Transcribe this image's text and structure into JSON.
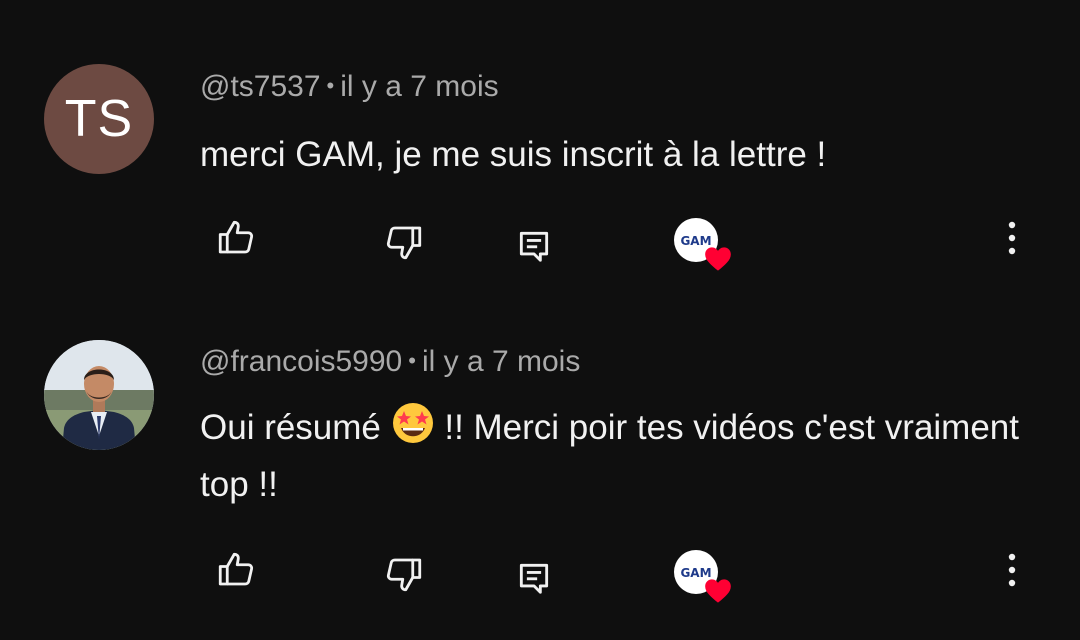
{
  "comments": [
    {
      "author": "@ts7537",
      "separator": "•",
      "time": "il y a 7 mois",
      "avatar_initials": "TS",
      "avatar_color": "#6d4a42",
      "text": "merci GAM, je me suis inscrit à la lettre !",
      "creator_badge": "GAM"
    },
    {
      "author": "@francois5990",
      "separator": "•",
      "time": "il y a 7 mois",
      "text_before_emoji": "Oui résumé ",
      "emoji": "star-struck-emoji",
      "text_after_emoji": " !! Merci poir tes vidéos c'est vraiment top !!",
      "creator_badge": "GAM"
    }
  ],
  "colors": {
    "background": "#0f0f0f",
    "primary_text": "#f1f1f1",
    "secondary_text": "#aaaaaa",
    "heart": "#ff0033"
  },
  "icons": {
    "like": "thumbs-up-icon",
    "dislike": "thumbs-down-icon",
    "reply": "reply-comment-icon",
    "heart": "creator-heart-icon",
    "more": "more-vertical-icon"
  }
}
